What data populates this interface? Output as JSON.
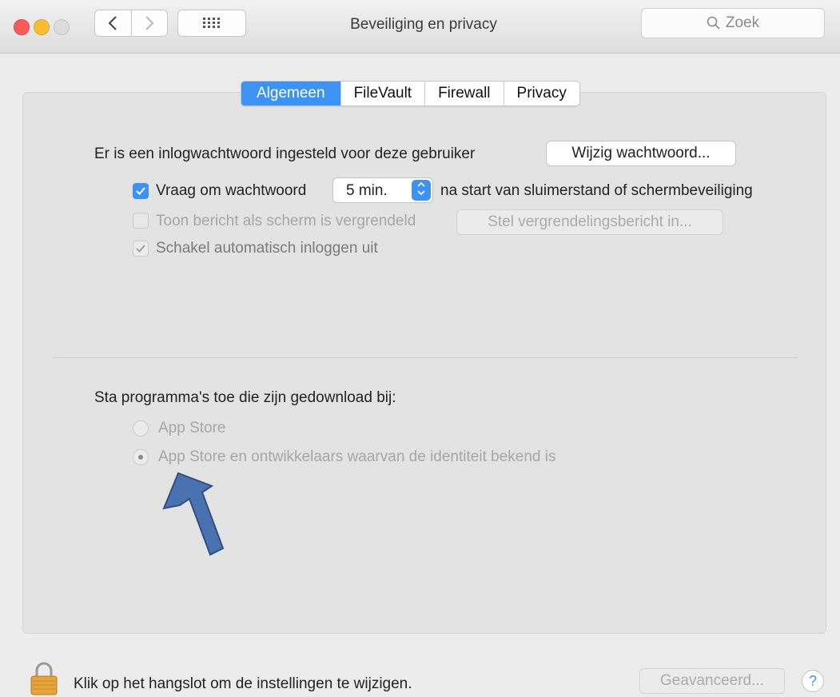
{
  "window": {
    "title": "Beveiliging en privacy",
    "search_placeholder": "Zoek",
    "back_icon": "chevron-left-icon",
    "forward_icon": "chevron-right-icon",
    "grid_icon": "grid-icon"
  },
  "tabs": [
    {
      "label": "Algemeen",
      "active": true
    },
    {
      "label": "FileVault",
      "active": false
    },
    {
      "label": "Firewall",
      "active": false
    },
    {
      "label": "Privacy",
      "active": false
    }
  ],
  "general": {
    "password_set_text": "Er is een inlogwachtwoord ingesteld voor deze gebruiker",
    "change_password_button": "Wijzig wachtwoord...",
    "require_password": {
      "checked": true,
      "label": "Vraag om wachtwoord",
      "delay_value": "5 min.",
      "suffix": "na start van sluimerstand of schermbeveiliging"
    },
    "show_message": {
      "checked": false,
      "label": "Toon bericht als scherm is vergrendeld",
      "button": "Stel vergrendelingsbericht in..."
    },
    "disable_auto_login": {
      "checked": true,
      "label": "Schakel automatisch inloggen uit"
    }
  },
  "downloads": {
    "heading": "Sta programma's toe die zijn gedownload bij:",
    "options": [
      {
        "label": "App Store",
        "selected": false
      },
      {
        "label": "App Store en ontwikkelaars waarvan de identiteit bekend is",
        "selected": true
      }
    ]
  },
  "footer": {
    "lock_text": "Klik op het hangslot om de instellingen te wijzigen.",
    "advanced_button": "Geavanceerd...",
    "help_label": "?"
  },
  "colors": {
    "accent": "#3d92f5",
    "annotation_arrow": "#4a72b0"
  }
}
